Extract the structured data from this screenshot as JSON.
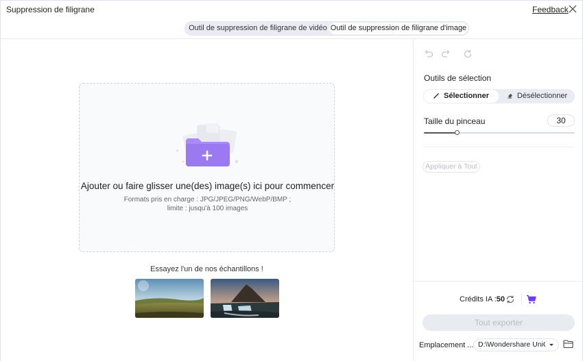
{
  "window": {
    "title": "Suppression de filigrane",
    "feedback_label": "Feedback",
    "close_icon": "close-icon"
  },
  "tabs": [
    {
      "label": "Outil de suppression de filigrane de vidéo",
      "active": false
    },
    {
      "label": "Outil de suppression de filigrane d'image",
      "active": true
    }
  ],
  "dropzone": {
    "title": "Ajouter ou faire glisser une(des) image(s) ici pour commencer",
    "formats_line1": "Formats pris en charge : JPG/JPEG/PNG/WebP/BMP ;",
    "formats_line2": "limite : jusqu'à 100 images",
    "icon": "add-folder-icon"
  },
  "samples": {
    "title": "Essayez l'un de nos échantillons !",
    "items": [
      "sample-landscape-meadow",
      "sample-mountain-waterfall"
    ]
  },
  "panel": {
    "history_icons": [
      "undo-icon",
      "redo-icon",
      "reset-icon"
    ],
    "selection_title": "Outils de sélection",
    "select_label": "Sélectionner",
    "deselect_label": "Désélectionner",
    "brush_label": "Taille du pinceau",
    "brush_value": "30",
    "brush_level": 0.22,
    "apply_all_label": "Appliquer à Tout",
    "credits_label": "Crédits IA :",
    "credits_value": "50",
    "export_label": "Tout exporter",
    "location_label": "Emplacement ...",
    "location_value": "D:\\Wondershare UniConverter",
    "colors": {
      "accent": "#8b5cf6",
      "cart": "#6d3df5",
      "disabled_text": "#b8bdc5"
    }
  }
}
